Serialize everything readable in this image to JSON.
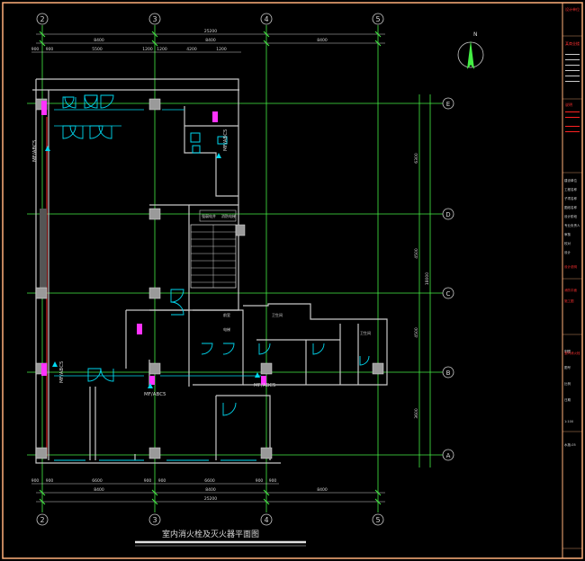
{
  "drawing": {
    "title": "室内消火栓及灭火器平面图",
    "north_label": "N",
    "axes_top": [
      "2",
      "3",
      "4",
      "5"
    ],
    "axes_right": [
      "E",
      "D",
      "C",
      "B",
      "A"
    ],
    "dim_top_total": "25200",
    "dim_top_spans": [
      "8400",
      "8400",
      "8400"
    ],
    "dim_top_sub": [
      "900",
      "900",
      "5500",
      "1200",
      "1200",
      "4200",
      "1200"
    ],
    "dim_bottom_total": "25200",
    "dim_bottom_spans": [
      "8400",
      "8400",
      "8400"
    ],
    "dim_bottom_sub": [
      "900",
      "900",
      "6600",
      "900",
      "900",
      "6600",
      "900",
      "900"
    ],
    "dim_right_total": "18000",
    "dim_right_spans": [
      "6300",
      "4500",
      "4500",
      "3600"
    ],
    "extinguisher_labels": [
      "MF/ABC5",
      "MF/ABC5",
      "MF/ABC5",
      "MF/ABC5",
      "MF/ABC5"
    ],
    "room_labels": [
      "强弱电井",
      "消防电梯",
      "前室",
      "电梯",
      "卫生间",
      "卫生间"
    ]
  },
  "title_block": {
    "header": "设计单位",
    "project": "某商业楼",
    "notes_title": "说明",
    "rows": [
      "建设单位",
      "工程名称",
      "子项名称",
      "图纸名称",
      "设计阶段",
      "专业负责人",
      "审核",
      "校对",
      "设计",
      "制图",
      "图号",
      "比例",
      "日期"
    ],
    "red_items": [
      "设计说明",
      "消防平面",
      "施工图",
      "室内消火栓"
    ],
    "scale": "1:100",
    "sheet": "水施-05"
  },
  "colors": {
    "frame": "#ffb07a",
    "wall": "#c8c8c8",
    "axis": "#44ee44",
    "dim": "#cccccc",
    "cyan": "#00d8f0",
    "magenta": "#ff33ff",
    "red": "#ff2222",
    "column": "#9a9a9a"
  }
}
